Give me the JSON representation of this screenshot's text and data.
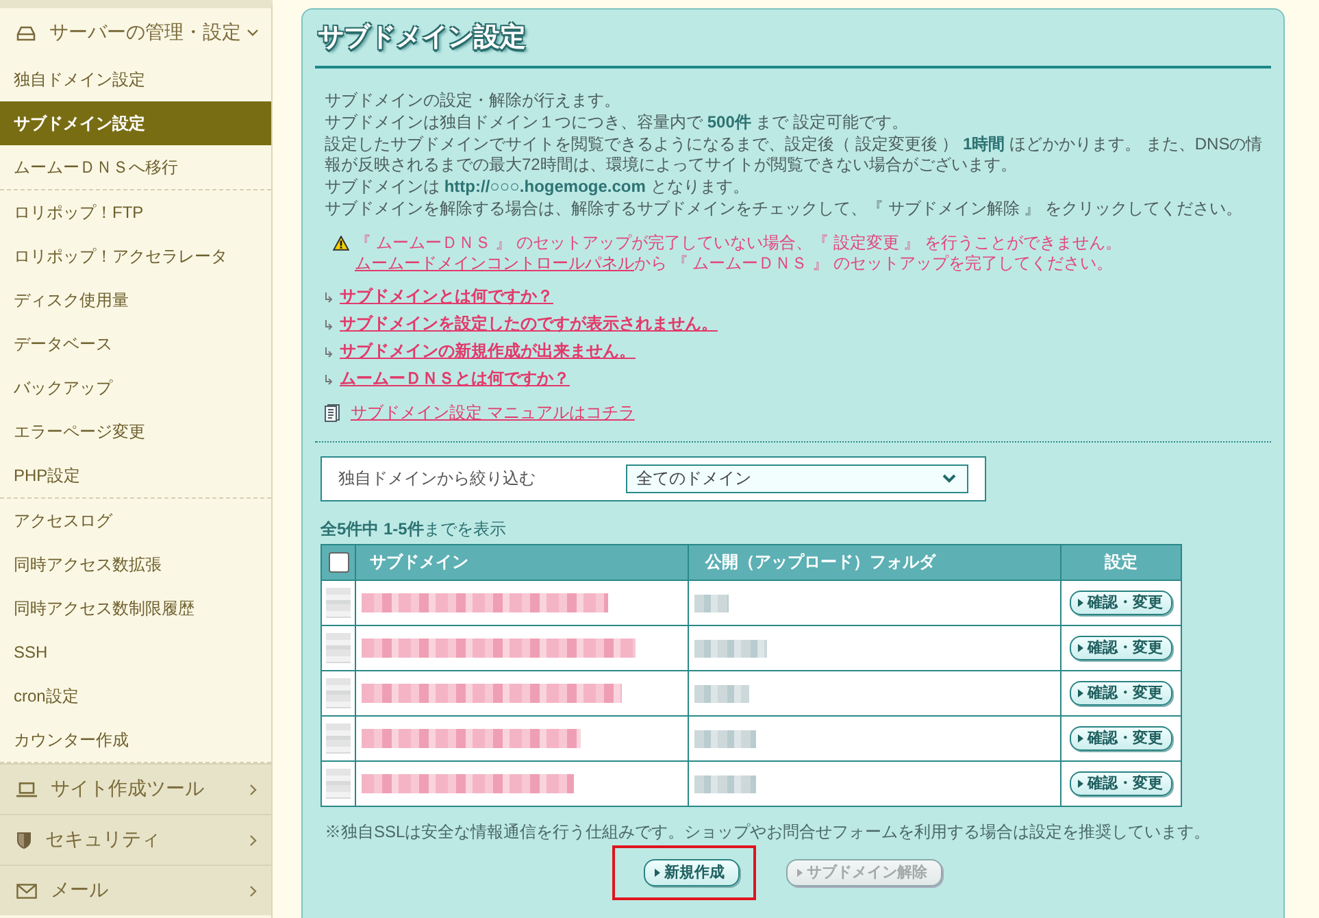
{
  "sidebar": {
    "sections": [
      {
        "label": "サーバーの管理・設定",
        "expanded": true,
        "groups": [
          {
            "items": [
              {
                "label": "独自ドメイン設定",
                "selected": false
              },
              {
                "label": "サブドメイン設定",
                "selected": true
              },
              {
                "label": "ムームーＤＮＳへ移行",
                "selected": false
              }
            ]
          },
          {
            "items": [
              {
                "label": "ロリポップ！FTP",
                "selected": false
              },
              {
                "label": "ロリポップ！アクセラレータ",
                "selected": false
              },
              {
                "label": "ディスク使用量",
                "selected": false
              },
              {
                "label": "データベース",
                "selected": false
              },
              {
                "label": "バックアップ",
                "selected": false
              },
              {
                "label": "エラーページ変更",
                "selected": false
              },
              {
                "label": "PHP設定",
                "selected": false
              }
            ]
          },
          {
            "items": [
              {
                "label": "アクセスログ",
                "selected": false
              },
              {
                "label": "同時アクセス数拡張",
                "selected": false
              },
              {
                "label": "同時アクセス数制限履歴",
                "selected": false
              },
              {
                "label": "SSH",
                "selected": false
              },
              {
                "label": "cron設定",
                "selected": false
              },
              {
                "label": "カウンター作成",
                "selected": false
              }
            ]
          }
        ]
      },
      {
        "label": "サイト作成ツール",
        "expanded": false
      },
      {
        "label": "セキュリティ",
        "expanded": false
      },
      {
        "label": "メール",
        "expanded": false
      }
    ]
  },
  "panel": {
    "title": "サブドメイン設定",
    "intro": [
      "サブドメインの設定・解除が行えます。",
      "サブドメインは独自ドメイン１つにつき、容量内で **500件** まで 設定可能です。",
      "設定したサブドメインでサイトを閲覧できるようになるまで、設定後（ 設定変更後 ） **1時間** ほどかかります。 また、DNSの情報が反映されるまでの最大72時間は、環境によってサイトが閲覧できない場合がございます。",
      "サブドメインは **http://○○○.hogemoge.com** となります。",
      "サブドメインを解除する場合は、解除するサブドメインをチェックして、『 サブドメイン解除 』 をクリックしてください。"
    ],
    "warning": {
      "text": "『 ムームーＤＮＳ 』 のセットアップが完了していない場合、『 設定変更 』 を行うことができません。",
      "link": "ムームードメインコントロールパネル",
      "after_link": "から 『 ムームーＤＮＳ 』 のセットアップを完了してください。"
    },
    "help_links": [
      "サブドメインとは何ですか？",
      "サブドメインを設定したのですが表示されません。",
      "サブドメインの新規作成が出来ません。",
      "ムームーＤＮＳとは何ですか？"
    ],
    "manual_link": "サブドメイン設定 マニュアルはコチラ",
    "filter": {
      "label": "独自ドメインから絞り込む",
      "value": "全てのドメイン"
    },
    "result_count": "**全5件中 1-5件**までを表示",
    "table": {
      "select_all_checked": false,
      "columns": [
        "サブドメイン",
        "公開（アップロード）フォルダ",
        "設定"
      ],
      "rows": [
        {
          "action": "確認・変更"
        },
        {
          "action": "確認・変更"
        },
        {
          "action": "確認・変更"
        },
        {
          "action": "確認・変更"
        },
        {
          "action": "確認・変更"
        }
      ]
    },
    "note": "※独自SSLは安全な情報通信を行う仕組みです。ショップやお問合せフォームを利用する場合は設定を推奨しています。",
    "buttons": [
      {
        "label": "新規作成",
        "disabled": false,
        "highlighted": true
      },
      {
        "label": "サブドメイン解除",
        "disabled": true,
        "highlighted": false
      }
    ]
  }
}
